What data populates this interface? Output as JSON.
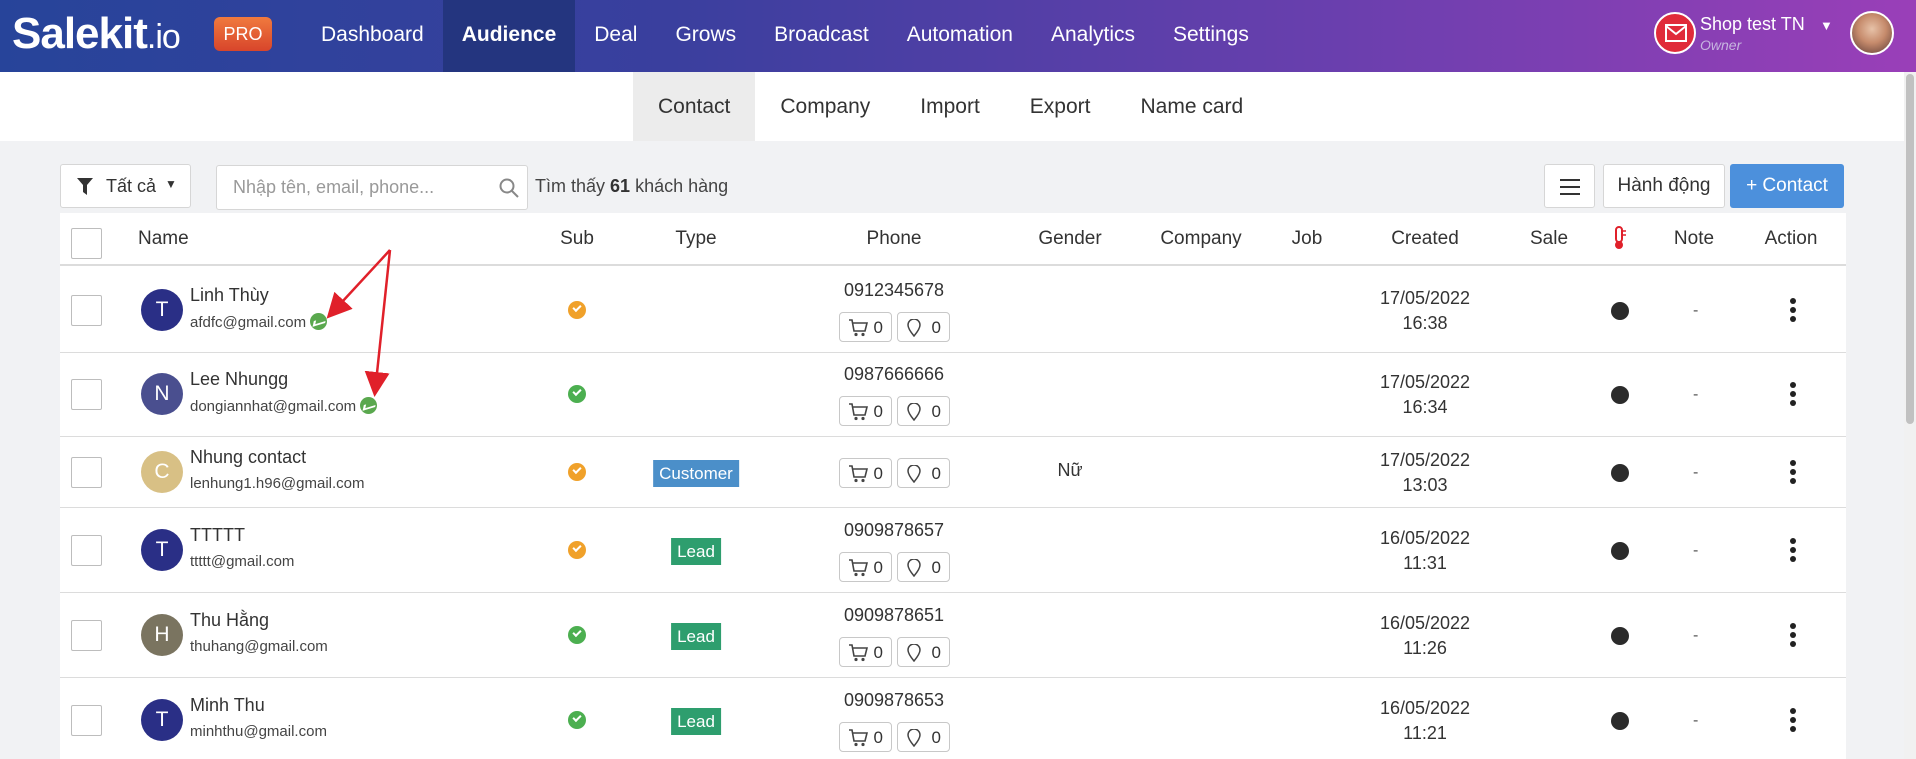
{
  "brand": {
    "name": "Salekit",
    "suffix": ".io",
    "badge": "PRO"
  },
  "nav": {
    "items": [
      {
        "label": "Dashboard"
      },
      {
        "label": "Audience"
      },
      {
        "label": "Deal"
      },
      {
        "label": "Grows"
      },
      {
        "label": "Broadcast"
      },
      {
        "label": "Automation"
      },
      {
        "label": "Analytics"
      },
      {
        "label": "Settings"
      }
    ],
    "active": "Audience"
  },
  "account": {
    "shop_name": "Shop test TN",
    "role": "Owner"
  },
  "subnav": {
    "items": [
      {
        "label": "Contact"
      },
      {
        "label": "Company"
      },
      {
        "label": "Import"
      },
      {
        "label": "Export"
      },
      {
        "label": "Name card"
      }
    ],
    "active": "Contact"
  },
  "toolbar": {
    "filter_label": "Tất cả",
    "search_placeholder": "Nhập tên, email, phone...",
    "found_prefix": "Tìm thấy",
    "found_count": "61",
    "found_suffix": "khách hàng",
    "action_label": "Hành động",
    "add_label": "+ Contact"
  },
  "table": {
    "columns": [
      "Name",
      "Sub",
      "Type",
      "Phone",
      "Gender",
      "Company",
      "Job",
      "Created",
      "Sale",
      "Note",
      "Action"
    ],
    "rows": [
      {
        "initial": "T",
        "avatar_color": "#2a2f86",
        "name": "Linh Thùy",
        "email": "afdfc@gmail.com",
        "messenger": true,
        "sub_color": "#f0a12a",
        "type": "",
        "type_color": "",
        "phone": "0912345678",
        "orders": "0",
        "visits": "0",
        "gender": "",
        "created_date": "17/05/2022",
        "created_time": "16:38",
        "note": "-"
      },
      {
        "initial": "N",
        "avatar_color": "#4a4f8f",
        "name": "Lee Nhungg",
        "email": "dongiannhat@gmail.com",
        "messenger": true,
        "sub_color": "#4caf50",
        "type": "",
        "type_color": "",
        "phone": "0987666666",
        "orders": "0",
        "visits": "0",
        "gender": "",
        "created_date": "17/05/2022",
        "created_time": "16:34",
        "note": "-"
      },
      {
        "initial": "C",
        "avatar_color": "#d8c085",
        "name": "Nhung contact",
        "email": "lenhung1.h96@gmail.com",
        "messenger": false,
        "sub_color": "#f0a12a",
        "type": "Customer",
        "type_color": "#4b8fc9",
        "phone": "",
        "orders": "0",
        "visits": "0",
        "gender": "Nữ",
        "created_date": "17/05/2022",
        "created_time": "13:03",
        "note": "-"
      },
      {
        "initial": "T",
        "avatar_color": "#2a2f86",
        "name": "TTTTT",
        "email": "ttttt@gmail.com",
        "messenger": false,
        "sub_color": "#f0a12a",
        "type": "Lead",
        "type_color": "#2e9e6e",
        "phone": "0909878657",
        "orders": "0",
        "visits": "0",
        "gender": "",
        "created_date": "16/05/2022",
        "created_time": "11:31",
        "note": "-"
      },
      {
        "initial": "H",
        "avatar_color": "#7a7460",
        "name": "Thu Hằng",
        "email": "thuhang@gmail.com",
        "messenger": false,
        "sub_color": "#4caf50",
        "type": "Lead",
        "type_color": "#2e9e6e",
        "phone": "0909878651",
        "orders": "0",
        "visits": "0",
        "gender": "",
        "created_date": "16/05/2022",
        "created_time": "11:26",
        "note": "-"
      },
      {
        "initial": "T",
        "avatar_color": "#2a2f86",
        "name": "Minh Thu",
        "email": "minhthu@gmail.com",
        "messenger": false,
        "sub_color": "#4caf50",
        "type": "Lead",
        "type_color": "#2e9e6e",
        "phone": "0909878653",
        "orders": "0",
        "visits": "0",
        "gender": "",
        "created_date": "16/05/2022",
        "created_time": "11:21",
        "note": "-"
      }
    ]
  },
  "icons": {
    "filter": "filter-icon",
    "search": "search-icon",
    "menu": "hamburger-icon",
    "cart": "cart-icon",
    "visit": "map-pin-icon",
    "temperature": "thermometer-icon",
    "messenger": "messenger-icon",
    "mail": "mail-icon"
  },
  "colors": {
    "accent": "#4c90dc",
    "nav_active": "#24357f",
    "annotation": "#e0202a"
  }
}
